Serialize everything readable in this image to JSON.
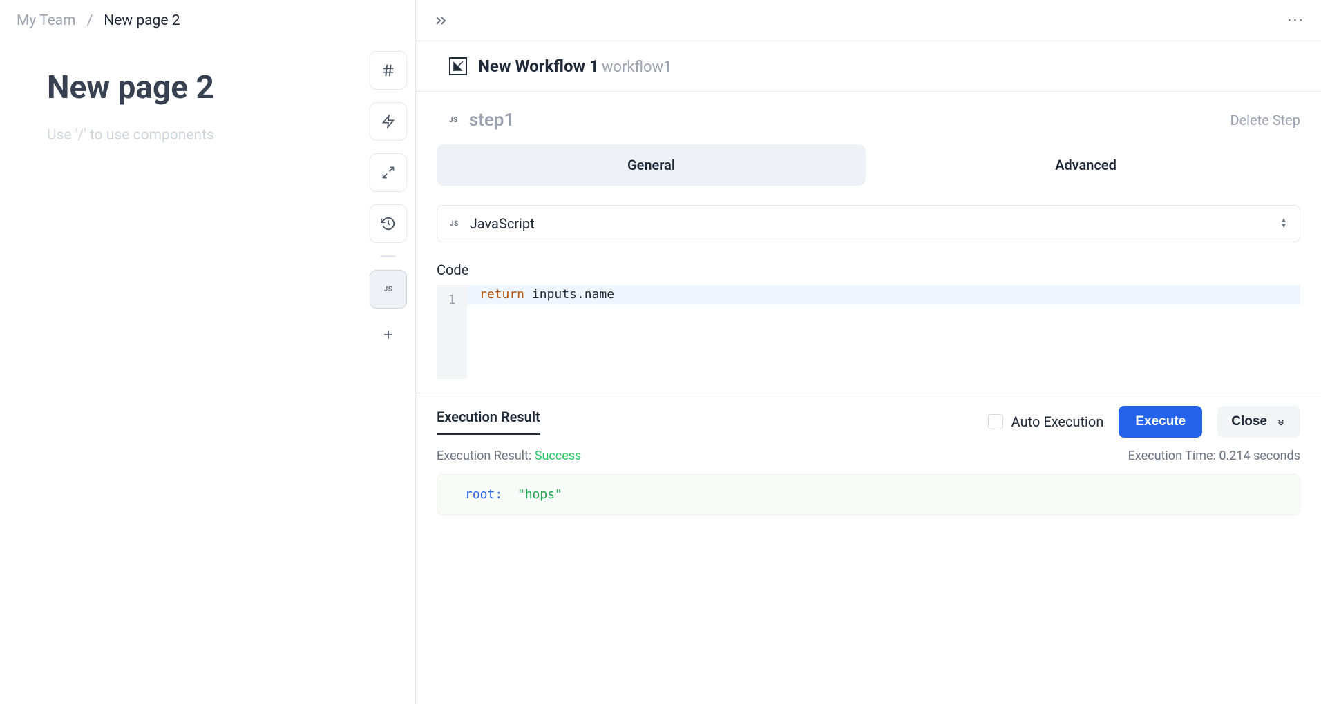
{
  "breadcrumb": {
    "team": "My Team",
    "sep": "/",
    "page": "New page 2"
  },
  "page": {
    "title": "New page 2",
    "placeholder": "Use '/' to use components"
  },
  "toolbar": {
    "js_badge": "JS"
  },
  "workflow": {
    "title": "New Workflow 1",
    "subtitle": "workflow1"
  },
  "step": {
    "js_badge": "JS",
    "name": "step1",
    "delete_label": "Delete Step"
  },
  "tabs": {
    "general": "General",
    "advanced": "Advanced"
  },
  "language": {
    "badge": "JS",
    "label": "JavaScript"
  },
  "code": {
    "label": "Code",
    "line_number": "1",
    "keyword": "return",
    "rest": " inputs.name"
  },
  "exec": {
    "tab_label": "Execution Result",
    "auto_label": "Auto Execution",
    "execute_label": "Execute",
    "close_label": "Close",
    "result_prefix": "Execution Result: ",
    "result_status": "Success",
    "time_prefix": "Execution Time: ",
    "time_value": "0.214 seconds",
    "root_key": "root:",
    "root_val": "\"hops\""
  }
}
